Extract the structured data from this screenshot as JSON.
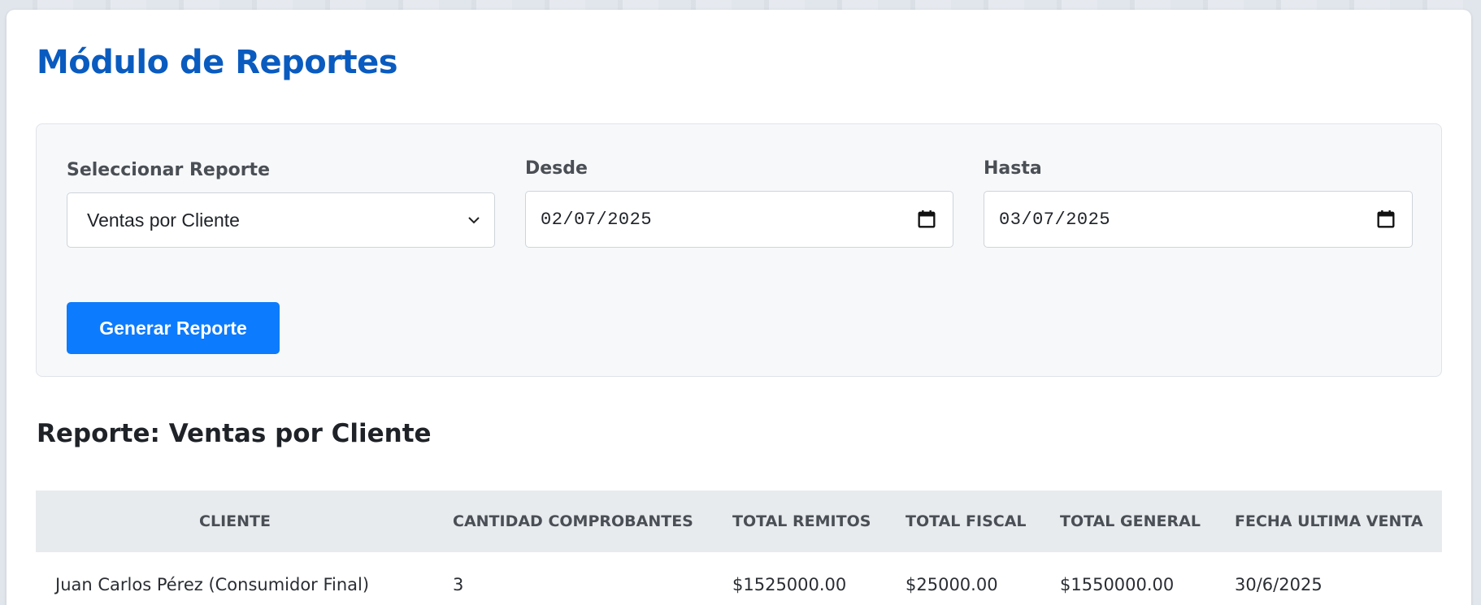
{
  "page": {
    "title": "Módulo de Reportes"
  },
  "filters": {
    "report_label": "Seleccionar Reporte",
    "report_selected": "Ventas por Cliente",
    "from_label": "Desde",
    "from_value": "02/07/2025",
    "to_label": "Hasta",
    "to_value": "03/07/2025",
    "generate_button": "Generar Reporte"
  },
  "report": {
    "title": "Reporte: Ventas por Cliente",
    "columns": [
      "CLIENTE",
      "CANTIDAD COMPROBANTES",
      "TOTAL REMITOS",
      "TOTAL FISCAL",
      "TOTAL GENERAL",
      "FECHA ULTIMA VENTA"
    ],
    "rows": [
      {
        "cliente": "Juan Carlos Pérez (Consumidor Final)",
        "cantidad": "3",
        "total_remitos": "$1525000.00",
        "total_fiscal": "$25000.00",
        "total_general": "$1550000.00",
        "fecha": "30/6/2025"
      }
    ]
  },
  "colors": {
    "title": "#0a5bbf",
    "primary_button": "#0d7bfd",
    "panel_bg": "#f7f8fa",
    "table_header_bg": "#e8ebee"
  },
  "icons": {
    "select_chevron": "chevron-down-icon",
    "date_picker": "calendar-icon"
  }
}
